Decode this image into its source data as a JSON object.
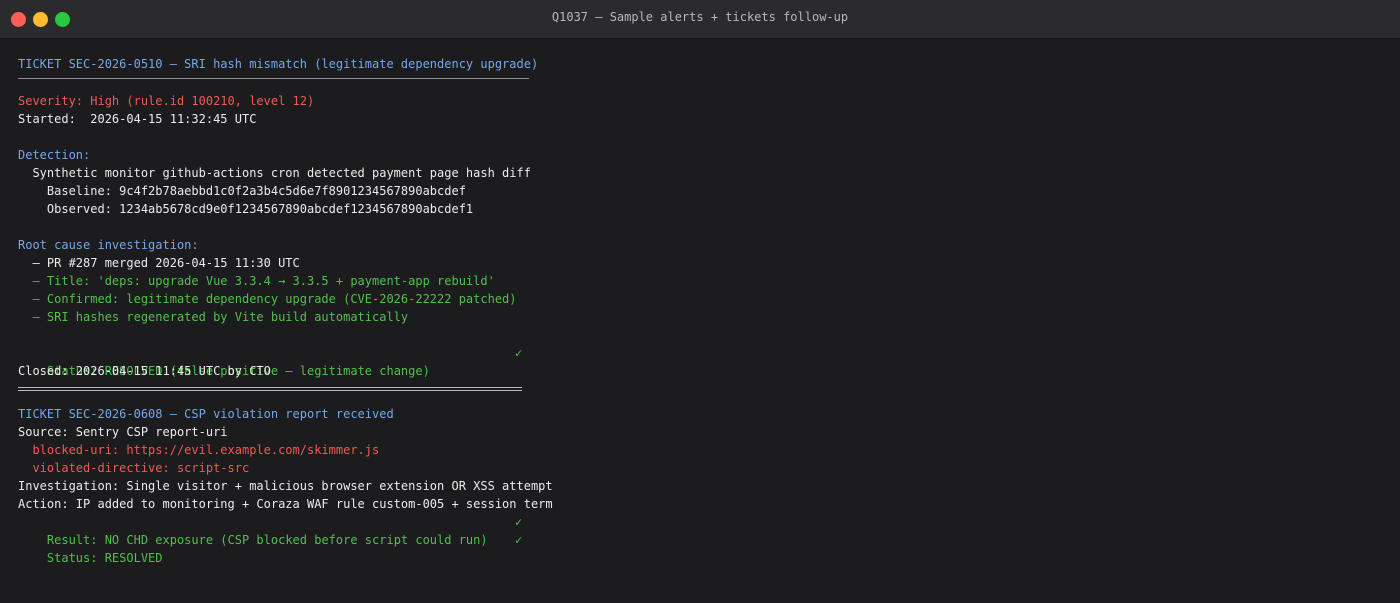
{
  "window": {
    "title": "Q1037 — Sample alerts + tickets follow-up"
  },
  "ticket1": {
    "header": "TICKET SEC-2026-0510 — SRI hash mismatch (legitimate dependency upgrade)",
    "severity": "Severity: High (rule.id 100210, level 12)",
    "started": "Started:  2026-04-15 11:32:45 UTC",
    "detection_label": "Detection:",
    "detection_summary": "  Synthetic monitor github-actions cron detected payment page hash diff",
    "baseline": "    Baseline: 9c4f2b78aebbd1c0f2a3b4c5d6e7f8901234567890abcdef",
    "observed": "    Observed: 1234ab5678cd9e0f1234567890abcdef1234567890abcdef1",
    "root_cause_label": "Root cause investigation:",
    "pr_line": "  — PR #287 merged 2026-04-15 11:30 UTC",
    "title_line": "  — Title: 'deps: upgrade Vue 3.3.4 → 3.3.5 + payment-app rebuild'",
    "confirmed_line": "  — Confirmed: legitimate dependency upgrade (CVE-2026-22222 patched)",
    "sri_line": "  — SRI hashes regenerated by Vite build automatically",
    "status": "Status: RESOLVED (false positive — legitimate change)",
    "status_check": "✓",
    "closed": "Closed: 2026-04-15 11:45 UTC by CTO"
  },
  "ticket2": {
    "header": "TICKET SEC-2026-0608 — CSP violation report received",
    "source": "Source: Sentry CSP report-uri",
    "blocked_uri": "  blocked-uri: https://evil.example.com/skimmer.js",
    "violated_directive": "  violated-directive: script-src",
    "investigation": "Investigation: Single visitor + malicious browser extension OR XSS attempt",
    "action": "Action: IP added to monitoring + Coraza WAF rule custom-005 + session term",
    "result": "Result: NO CHD exposure (CSP blocked before script could run)",
    "result_check": "✓",
    "status": "Status: RESOLVED",
    "status_check": "✓"
  }
}
